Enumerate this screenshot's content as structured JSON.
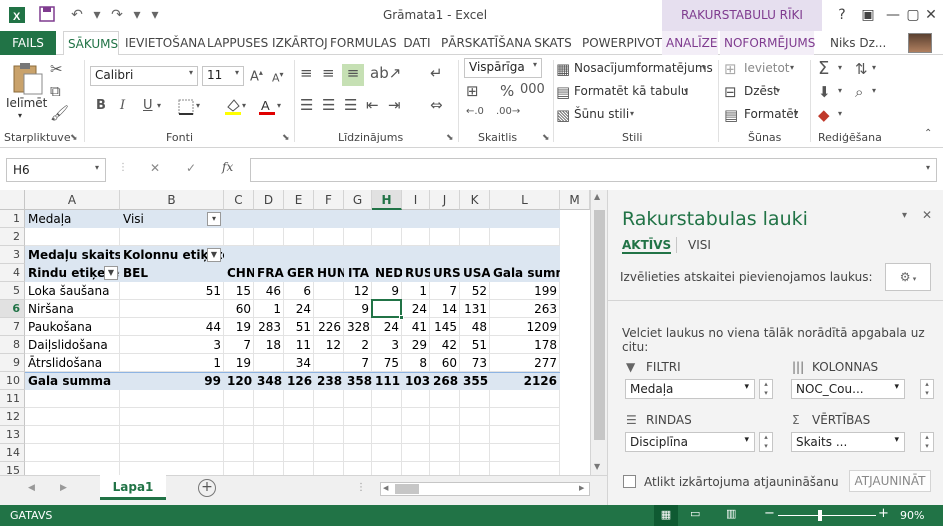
{
  "window": {
    "title": "Grāmata1 - Excel",
    "contextual_header": "RAKURSTABULU RĪKI",
    "user_name": "Niks Dz..."
  },
  "tabs": [
    "FAILS",
    "SĀKUMS",
    "IEVIETOŠANA",
    "LAPPUSES IZKĀRTOJ",
    "FORMULAS",
    "DATI",
    "PĀRSKATĪŠANA",
    "SKATS",
    "POWERPIVOT",
    "ANALĪZE",
    "NOFORMĒJUMS"
  ],
  "ribbon": {
    "clipboard": {
      "paste_label": "Ielīmēt",
      "group": "Starpliktuve"
    },
    "font": {
      "name": "Calibri",
      "size": "11",
      "group": "Fonti"
    },
    "alignment": {
      "group": "Līdzinājums"
    },
    "number": {
      "format": "Vispārīga",
      "group": "Skaitlis"
    },
    "styles": {
      "conditional": "Nosacījumformatējums",
      "as_table": "Formatēt kā tabulu",
      "cell_styles": "Šūnu stili",
      "group": "Stili"
    },
    "cells": {
      "insert": "Ievietot",
      "delete": "Dzēst",
      "format": "Formatēt",
      "group": "Šūnas"
    },
    "editing": {
      "group": "Rediģēšana"
    }
  },
  "formula_bar": {
    "name_box": "H6",
    "fx": "fx",
    "content": ""
  },
  "sheet": {
    "columns": [
      "A",
      "B",
      "C",
      "D",
      "E",
      "F",
      "G",
      "H",
      "I",
      "J",
      "K",
      "L",
      "M"
    ],
    "rows": [
      "1",
      "2",
      "3",
      "4",
      "5",
      "6",
      "7",
      "8",
      "9",
      "10",
      "11",
      "12",
      "13",
      "14",
      "15"
    ],
    "filter": {
      "label": "Medaļa",
      "value": "Visi"
    },
    "pivot": {
      "values_label": "Medaļu skaits",
      "col_labels": "Kolonnu etiķete",
      "row_labels": "Rindu etiķetes",
      "headers": [
        "BEL",
        "CHN",
        "FRA",
        "GER",
        "HUN",
        "ITA",
        "NED",
        "RUS",
        "URS",
        "USA",
        "Gala summa"
      ],
      "rows": [
        {
          "label": "Loka šaušana",
          "values": [
            "51",
            "15",
            "46",
            "6",
            "",
            "12",
            "9",
            "1",
            "7",
            "52",
            "199"
          ]
        },
        {
          "label": "Niršana",
          "values": [
            "",
            "60",
            "1",
            "24",
            "",
            "9",
            "",
            "24",
            "14",
            "131",
            "263"
          ]
        },
        {
          "label": "Paukošana",
          "values": [
            "44",
            "19",
            "283",
            "51",
            "226",
            "328",
            "24",
            "41",
            "145",
            "48",
            "1209"
          ]
        },
        {
          "label": "Daiļslidošana",
          "values": [
            "3",
            "7",
            "18",
            "11",
            "12",
            "2",
            "3",
            "29",
            "42",
            "51",
            "178"
          ]
        },
        {
          "label": "Ātrslidošana",
          "values": [
            "1",
            "19",
            "",
            "34",
            "",
            "7",
            "75",
            "8",
            "60",
            "73",
            "277"
          ]
        }
      ],
      "total": {
        "label": "Gala summa",
        "values": [
          "99",
          "120",
          "348",
          "126",
          "238",
          "358",
          "111",
          "103",
          "268",
          "355",
          "2126"
        ]
      }
    }
  },
  "sheet_tab": "Lapa1",
  "status": {
    "mode": "GATAVS",
    "zoom": "90%"
  },
  "pane": {
    "title": "Rakurstabulas lauki",
    "tab_active": "AKTĪVS",
    "tab_all": "VISI",
    "choose_label": "Izvēlieties atskaitei pievienojamos laukus:",
    "drag_label": "Velciet laukus no viena tālāk norādītā apgabala uz citu:",
    "filters": {
      "label": "FILTRI",
      "value": "Medaļa"
    },
    "columns": {
      "label": "KOLONNAS",
      "value": "NOC_Cou..."
    },
    "rows": {
      "label": "RINDAS",
      "value": "Disciplīna"
    },
    "values": {
      "label": "VĒRTĪBAS",
      "value": "Skaits ..."
    },
    "defer_label": "Atlikt izkārtojuma atjaunināšanu",
    "update_button": "ATJAUNINĀT"
  },
  "colors": {
    "excel_green": "#217346",
    "contextual_purple": "#7f3b8f",
    "pivot_band": "#dce6f1",
    "selected_header": "#e1e1e1"
  }
}
